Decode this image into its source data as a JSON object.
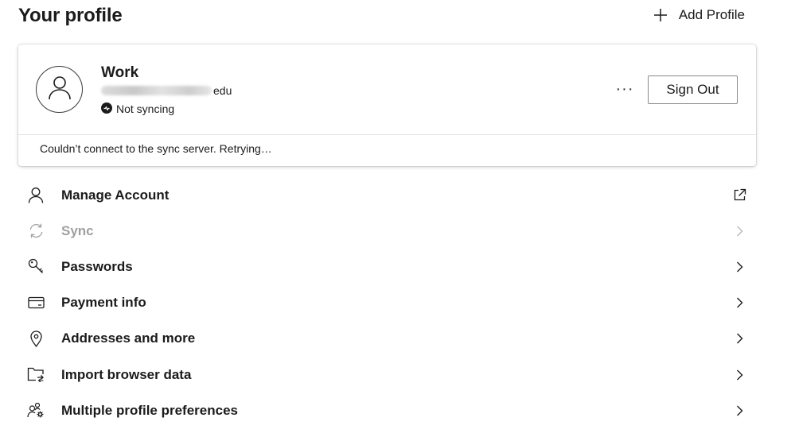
{
  "header": {
    "title": "Your profile",
    "add_profile_label": "Add Profile"
  },
  "profile": {
    "name": "Work",
    "email_suffix": "edu",
    "sync_status": "Not syncing",
    "more_label": "···",
    "sign_out_label": "Sign Out",
    "sync_error": "Couldn’t connect to the sync server. Retrying…"
  },
  "menu": {
    "items": [
      {
        "label": "Manage Account",
        "icon": "person-icon",
        "trailing": "external-link-icon",
        "disabled": false
      },
      {
        "label": "Sync",
        "icon": "sync-icon",
        "trailing": "chevron-right-icon",
        "disabled": true
      },
      {
        "label": "Passwords",
        "icon": "key-icon",
        "trailing": "chevron-right-icon",
        "disabled": false
      },
      {
        "label": "Payment info",
        "icon": "credit-card-icon",
        "trailing": "chevron-right-icon",
        "disabled": false
      },
      {
        "label": "Addresses and more",
        "icon": "location-pin-icon",
        "trailing": "chevron-right-icon",
        "disabled": false
      },
      {
        "label": "Import browser data",
        "icon": "folder-import-icon",
        "trailing": "chevron-right-icon",
        "disabled": false
      },
      {
        "label": "Multiple profile preferences",
        "icon": "profile-settings-icon",
        "trailing": "chevron-right-icon",
        "disabled": false
      }
    ]
  },
  "colors": {
    "text": "#1b1b1b",
    "disabled_text": "#a0a0a0",
    "card_border": "#e3e3e3"
  }
}
